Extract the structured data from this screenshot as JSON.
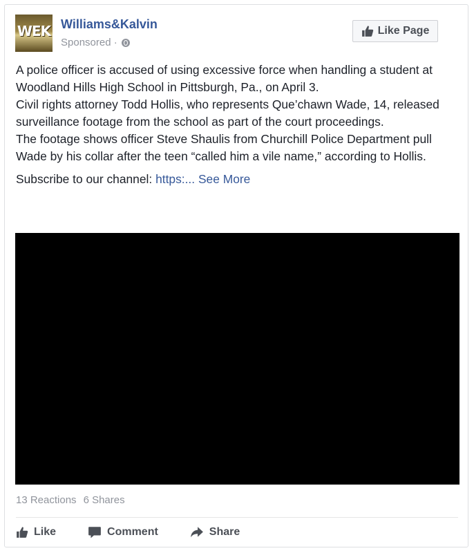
{
  "post": {
    "page_name": "Williams&Kalvin",
    "logo_text": "WEK",
    "sponsored": "Sponsored ·",
    "like_page": "Like Page",
    "text_lines": [
      "A police officer is accused of using excessive force when handling a student at Woodland Hills High School in Pittsburgh, Pa., on April 3.",
      "Civil rights attorney Todd Hollis, who represents Que’chawn Wade, 14, released surveillance footage from the school as part of the court proceedings.",
      "The footage shows officer Steve Shaulis from Churchill Police Department pull Wade by his collar after the teen “called him a vile name,” according to Hollis."
    ],
    "subscribe_prefix": "Subscribe to our channel: ",
    "subscribe_link": "https:...",
    "see_more": "See More"
  },
  "stats": {
    "reactions": "13 Reactions",
    "shares": "6 Shares"
  },
  "actions": {
    "like": "Like",
    "comment": "Comment",
    "share": "Share"
  },
  "icons": {
    "globe": "globe-icon",
    "thumb": "thumbs-up-icon",
    "comment": "comment-icon",
    "share": "share-arrow-icon"
  },
  "colors": {
    "link": "#365899",
    "text": "#1d2129",
    "muted": "#90949c",
    "video": "#000000"
  }
}
